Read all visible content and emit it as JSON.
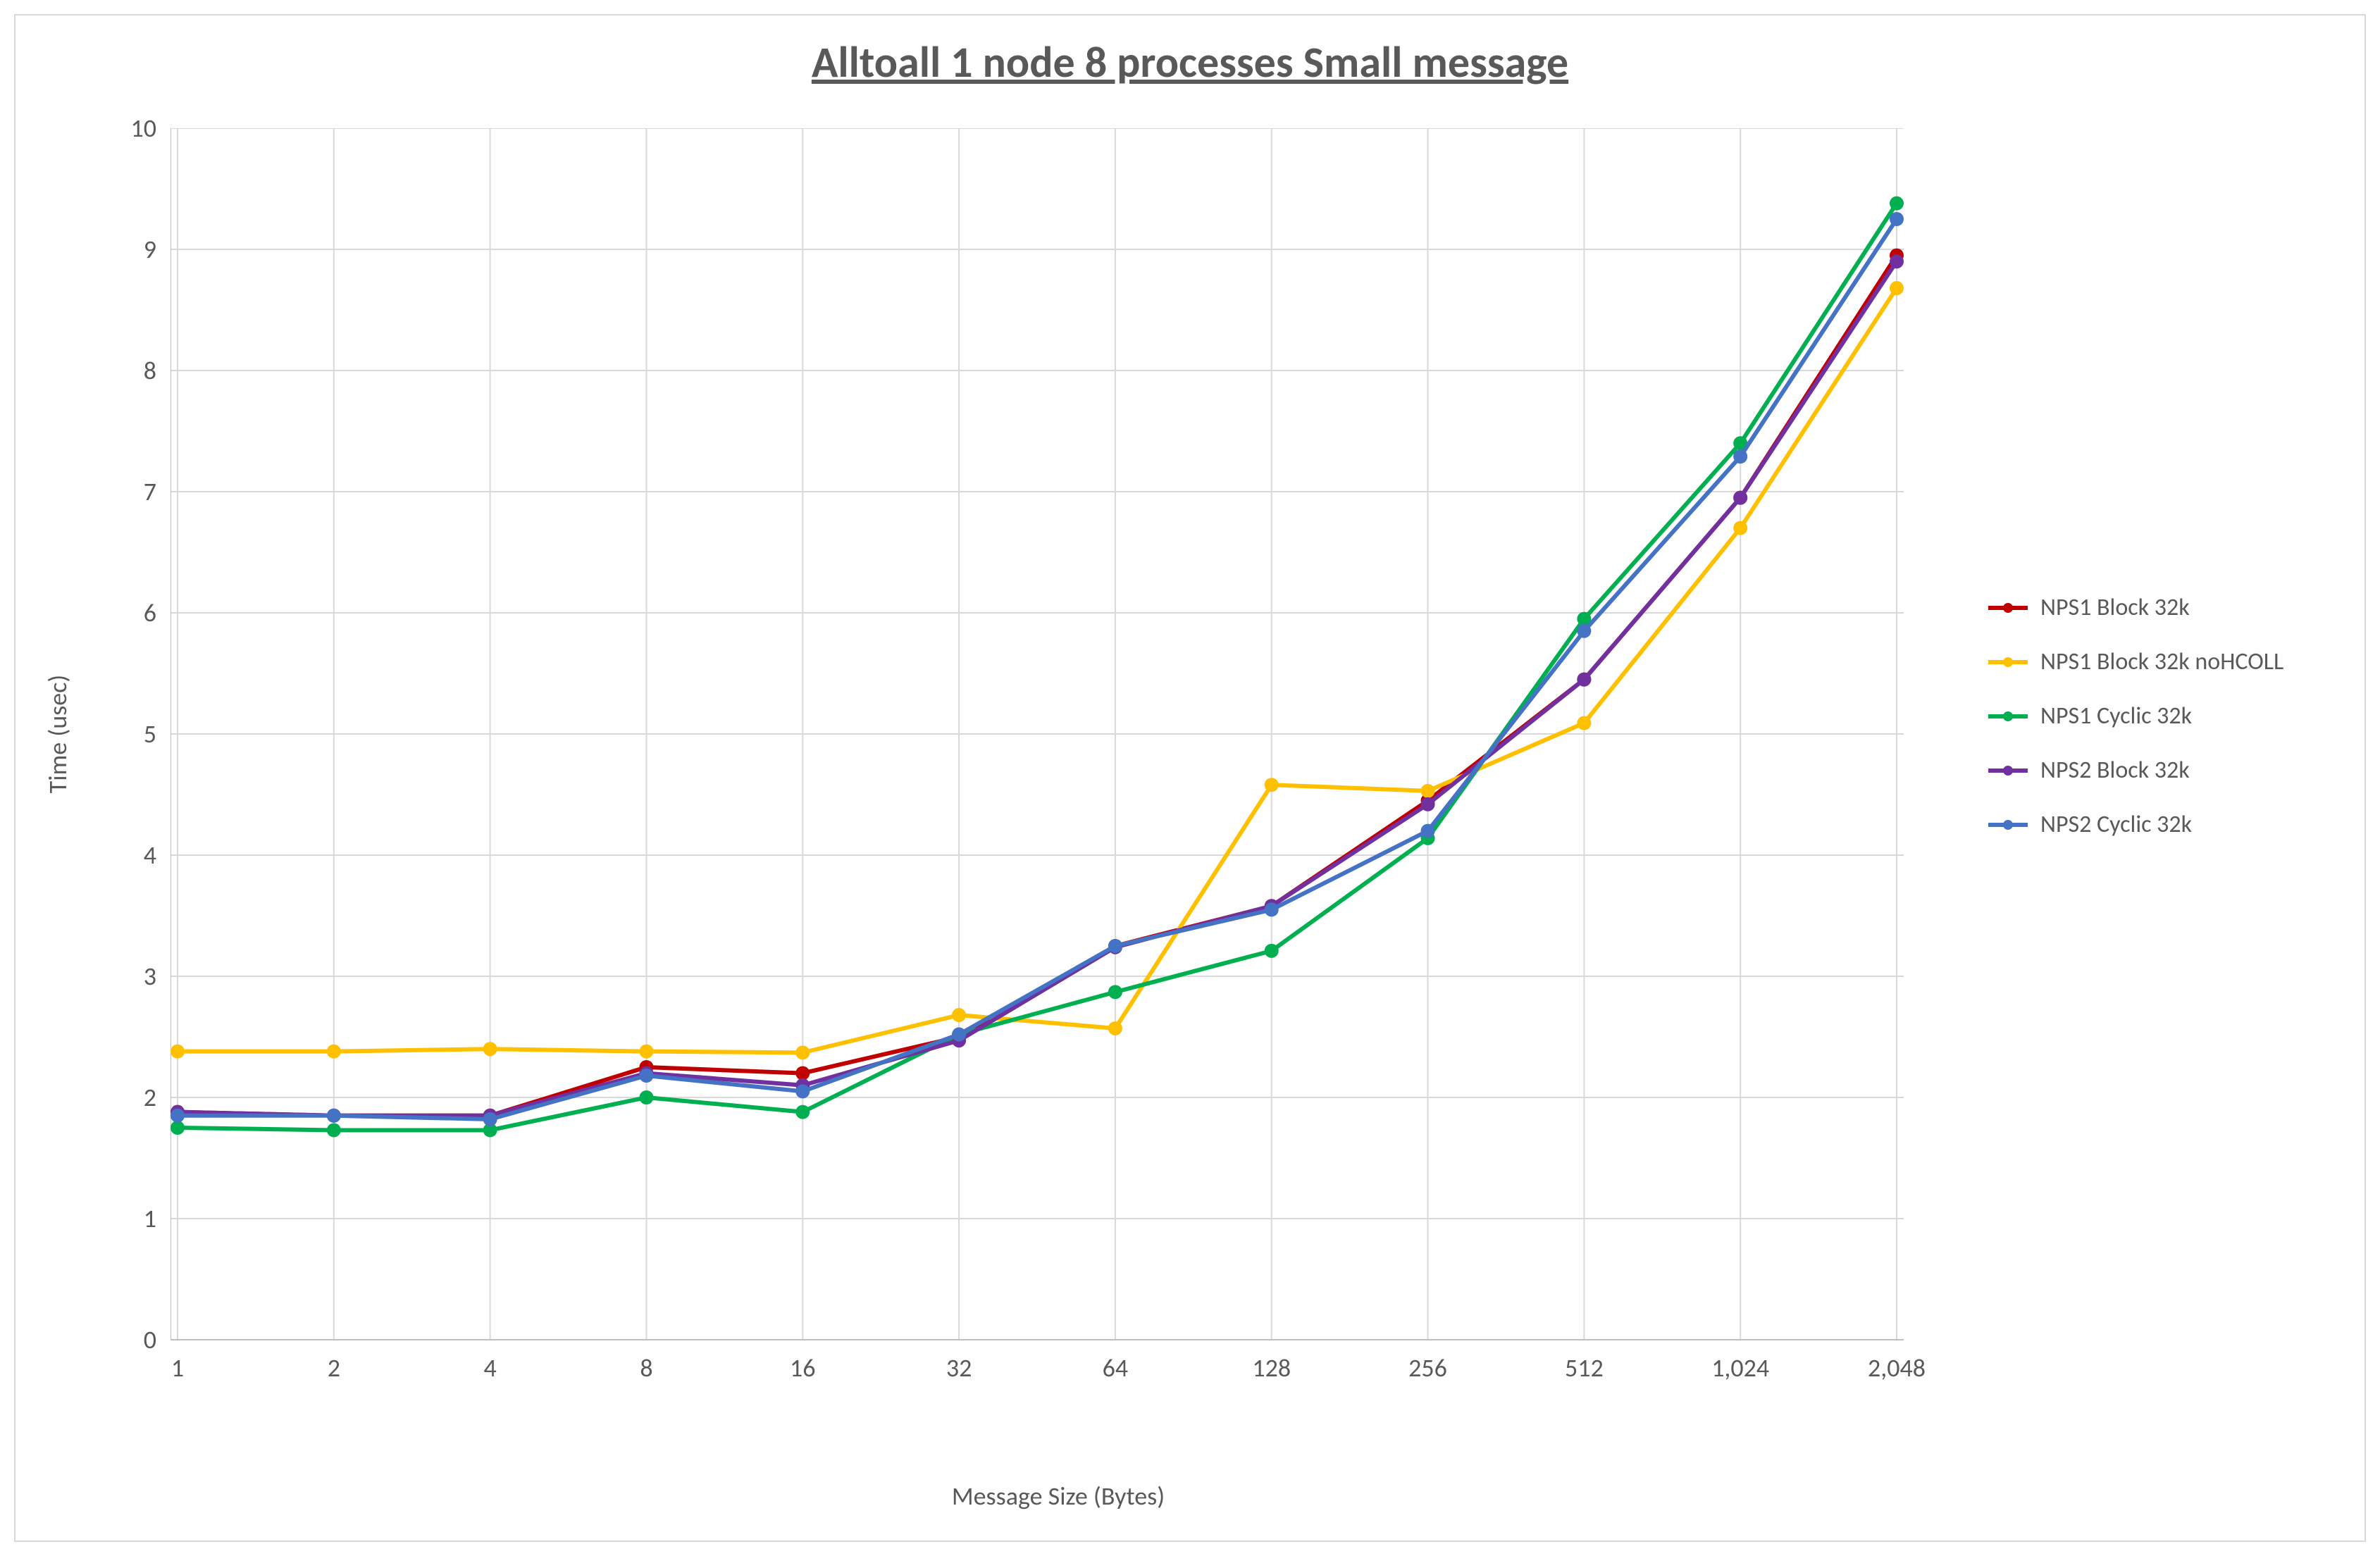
{
  "chart_data": {
    "type": "line",
    "title": "Alltoall 1 node 8 processes Small message",
    "xlabel": "Message Size (Bytes)",
    "ylabel": "Time (usec)",
    "ylim": [
      0,
      10
    ],
    "x_scale": "log2",
    "categories": [
      1,
      2,
      4,
      8,
      16,
      32,
      64,
      128,
      256,
      512,
      1024,
      2048
    ],
    "x_tick_labels": [
      "1",
      "2",
      "4",
      "8",
      "16",
      "32",
      "64",
      "128",
      "256",
      "512",
      "1,024",
      "2,048"
    ],
    "y_ticks": [
      0,
      1,
      2,
      3,
      4,
      5,
      6,
      7,
      8,
      9,
      10
    ],
    "series": [
      {
        "name": "NPS1 Block 32k",
        "color": "#C00000",
        "values": [
          1.88,
          1.85,
          1.85,
          2.25,
          2.2,
          2.5,
          3.25,
          3.58,
          4.45,
          5.45,
          6.95,
          8.95
        ]
      },
      {
        "name": "NPS1 Block 32k noHCOLL",
        "color": "#FFC000",
        "values": [
          2.38,
          2.38,
          2.4,
          2.38,
          2.37,
          2.68,
          2.57,
          4.58,
          4.53,
          5.09,
          6.7,
          8.68
        ]
      },
      {
        "name": "NPS1 Cyclic 32k",
        "color": "#00B050",
        "values": [
          1.75,
          1.73,
          1.73,
          2.0,
          1.88,
          2.52,
          2.87,
          3.21,
          4.14,
          5.95,
          7.4,
          9.38
        ]
      },
      {
        "name": "NPS2 Block 32k",
        "color": "#7030A0",
        "values": [
          1.88,
          1.85,
          1.85,
          2.2,
          2.1,
          2.47,
          3.24,
          3.58,
          4.42,
          5.45,
          6.95,
          8.9
        ]
      },
      {
        "name": "NPS2 Cyclic 32k",
        "color": "#4472C4",
        "values": [
          1.85,
          1.85,
          1.82,
          2.18,
          2.05,
          2.52,
          3.25,
          3.55,
          4.2,
          5.85,
          7.29,
          9.25
        ]
      }
    ],
    "legend_position": "right",
    "grid": true
  }
}
